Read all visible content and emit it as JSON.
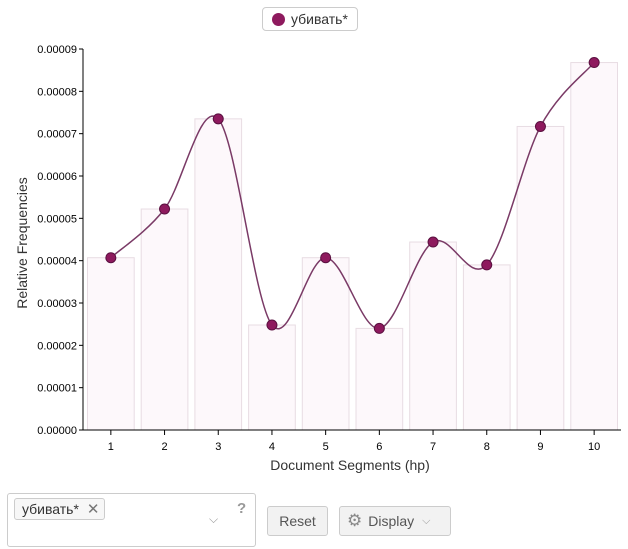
{
  "chart_data": {
    "type": "bar+line",
    "categories": [
      "1",
      "2",
      "3",
      "4",
      "5",
      "6",
      "7",
      "8",
      "9",
      "10"
    ],
    "series": [
      {
        "name": "убивать*",
        "values": [
          4.07e-05,
          5.22e-05,
          7.35e-05,
          2.48e-05,
          4.07e-05,
          2.4e-05,
          4.44e-05,
          3.9e-05,
          7.17e-05,
          8.68e-05
        ]
      }
    ],
    "xlabel": "Document Segments (hp)",
    "ylabel": "Relative Frequencies",
    "ylim": [
      0,
      9e-05
    ],
    "yticks": [
      "0.00000",
      "0.00001",
      "0.00002",
      "0.00003",
      "0.00004",
      "0.00005",
      "0.00006",
      "0.00007",
      "0.00008",
      "0.00009"
    ],
    "colors": {
      "point": "#8e1a5e",
      "line": "#7a3a66",
      "bar_fill": "#fdf8fb",
      "bar_stroke": "#e8dce3"
    },
    "grid": false,
    "legend_position": "top-center"
  },
  "legend": {
    "label": "убивать*"
  },
  "controls": {
    "term_tag": "убивать*",
    "remove_symbol": "✕",
    "dropdown_symbol": "⌵",
    "help_symbol": "?",
    "reset_label": "Reset",
    "display_label": "Display",
    "gear_symbol": "⚙",
    "display_chevron": "⌵"
  }
}
